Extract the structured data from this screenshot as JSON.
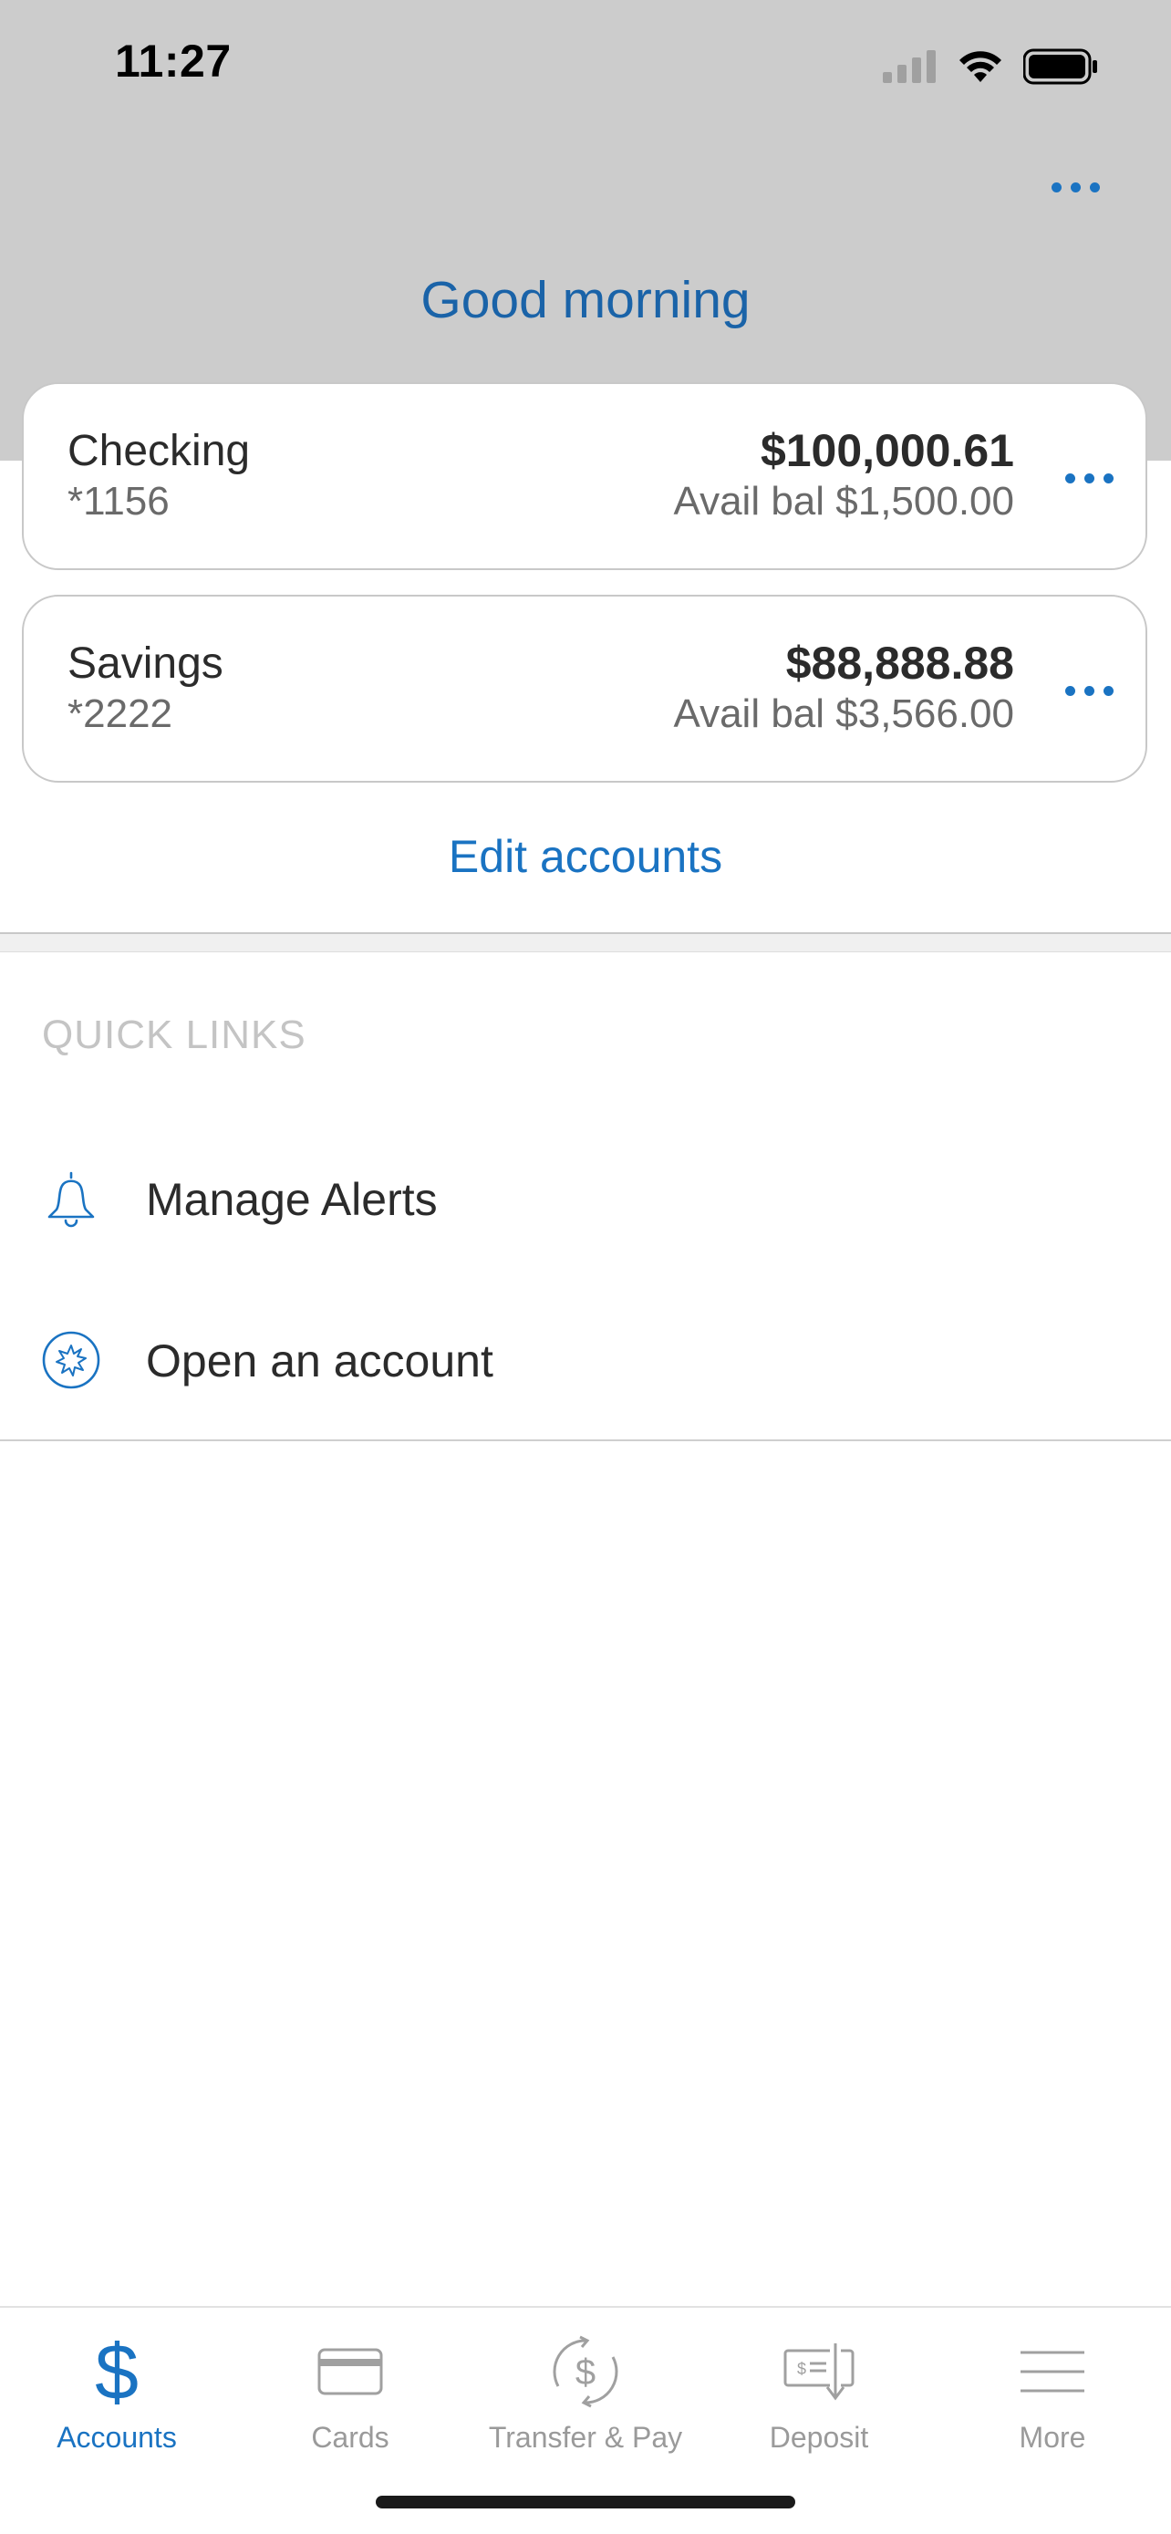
{
  "status_bar": {
    "time": "11:27"
  },
  "header": {
    "greeting": "Good morning"
  },
  "accounts": [
    {
      "name": "Checking",
      "number": "*1156",
      "balance": "$100,000.61",
      "available": "Avail bal $1,500.00"
    },
    {
      "name": "Savings",
      "number": "*2222",
      "balance": "$88,888.88",
      "available": "Avail bal $3,566.00"
    }
  ],
  "edit_accounts_label": "Edit accounts",
  "quick_links": {
    "title": "QUICK LINKS",
    "items": [
      {
        "label": "Manage Alerts",
        "icon": "bell-icon"
      },
      {
        "label": "Open an account",
        "icon": "open-account-icon"
      }
    ]
  },
  "tabbar": {
    "active": "Accounts",
    "items": [
      {
        "label": "Accounts",
        "icon": "dollar-icon"
      },
      {
        "label": "Cards",
        "icon": "card-icon"
      },
      {
        "label": "Transfer & Pay",
        "icon": "transfer-icon"
      },
      {
        "label": "Deposit",
        "icon": "deposit-check-icon"
      },
      {
        "label": "More",
        "icon": "menu-icon"
      }
    ]
  },
  "colors": {
    "accent": "#1a73c2",
    "header_bg": "#cccccc",
    "greeting": "#1a63a8"
  }
}
